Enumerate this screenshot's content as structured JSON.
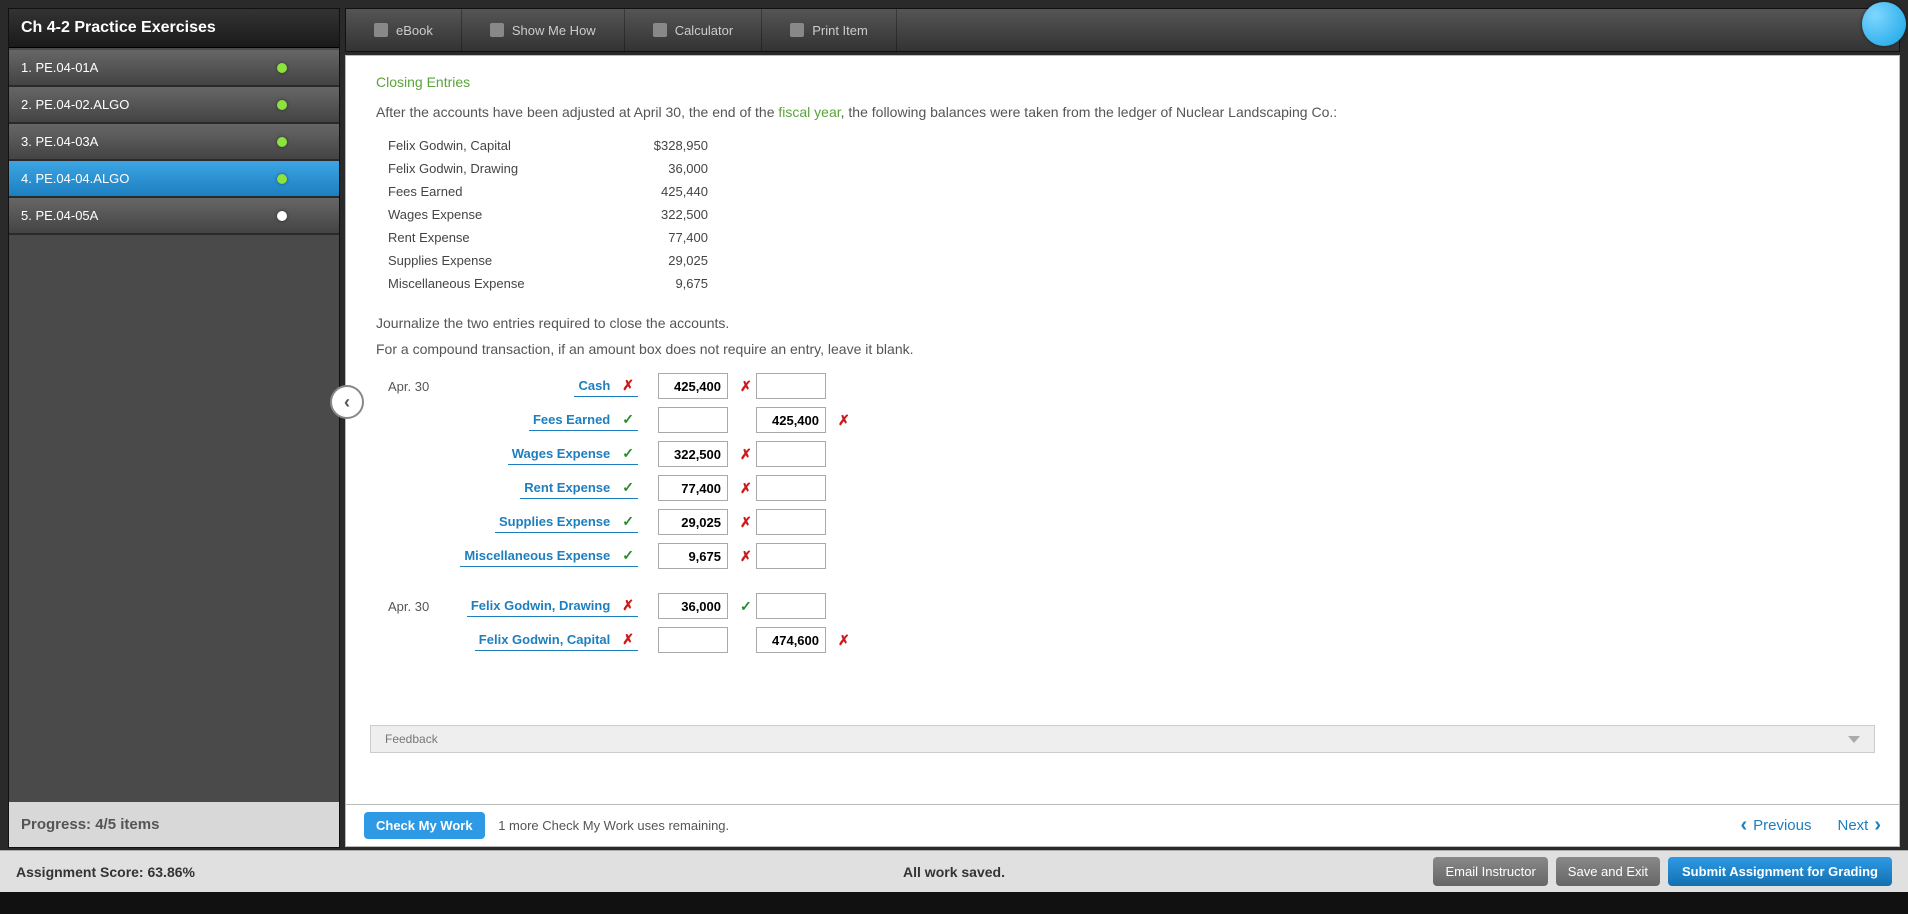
{
  "sidebar": {
    "title": "Ch 4-2 Practice Exercises",
    "items": [
      {
        "label": "1. PE.04-01A",
        "status": "done"
      },
      {
        "label": "2. PE.04-02.ALGO",
        "status": "done"
      },
      {
        "label": "3. PE.04-03A",
        "status": "done"
      },
      {
        "label": "4. PE.04-04.ALGO",
        "status": "current"
      },
      {
        "label": "5. PE.04-05A",
        "status": "not"
      }
    ],
    "progress_label": "Progress:",
    "progress_value": "4/5 items"
  },
  "toolbar": {
    "ebook": "eBook",
    "show_me_how": "Show Me How",
    "calculator": "Calculator",
    "print_item": "Print Item"
  },
  "content": {
    "heading": "Closing Entries",
    "intro_pre": "After the accounts have been adjusted at April 30, the end of the ",
    "intro_link": "fiscal year",
    "intro_post": ", the following balances were taken from the ledger of Nuclear Landscaping Co.:",
    "balances": [
      {
        "label": "Felix Godwin, Capital",
        "value": "$328,950"
      },
      {
        "label": "Felix Godwin, Drawing",
        "value": "36,000"
      },
      {
        "label": "Fees Earned",
        "value": "425,440"
      },
      {
        "label": "Wages Expense",
        "value": "322,500"
      },
      {
        "label": "Rent Expense",
        "value": "77,400"
      },
      {
        "label": "Supplies Expense",
        "value": "29,025"
      },
      {
        "label": "Miscellaneous Expense",
        "value": "9,675"
      }
    ],
    "note1": "Journalize the two entries required to close the accounts.",
    "note2": "For a compound transaction, if an amount box does not require an entry, leave it blank.",
    "journal1": {
      "date": "Apr. 30",
      "rows": [
        {
          "account": "Cash",
          "acct_mark": "wrong",
          "debit": "425,400",
          "debit_mark": "wrong",
          "credit": "",
          "credit_mark": ""
        },
        {
          "account": "Fees Earned",
          "acct_mark": "correct",
          "indent": true,
          "debit": "",
          "debit_mark": "",
          "credit": "425,400",
          "credit_mark": "wrong"
        },
        {
          "account": "Wages Expense",
          "acct_mark": "correct",
          "debit": "322,500",
          "debit_mark": "wrong",
          "credit": "",
          "credit_mark": ""
        },
        {
          "account": "Rent Expense",
          "acct_mark": "correct",
          "debit": "77,400",
          "debit_mark": "wrong",
          "credit": "",
          "credit_mark": ""
        },
        {
          "account": "Supplies Expense",
          "acct_mark": "correct",
          "debit": "29,025",
          "debit_mark": "wrong",
          "credit": "",
          "credit_mark": ""
        },
        {
          "account": "Miscellaneous Expense",
          "acct_mark": "correct",
          "debit": "9,675",
          "debit_mark": "wrong",
          "credit": "",
          "credit_mark": ""
        }
      ]
    },
    "journal2": {
      "date": "Apr. 30",
      "rows": [
        {
          "account": "Felix Godwin, Drawing",
          "acct_mark": "wrong",
          "debit": "36,000",
          "debit_mark": "correct",
          "credit": "",
          "credit_mark": ""
        },
        {
          "account": "Felix Godwin, Capital",
          "acct_mark": "wrong",
          "indent": true,
          "debit": "",
          "debit_mark": "",
          "credit": "474,600",
          "credit_mark": "wrong"
        }
      ]
    },
    "feedback_label": "Feedback"
  },
  "checkbar": {
    "button": "Check My Work",
    "remaining": "1 more Check My Work uses remaining.",
    "previous": "Previous",
    "next": "Next"
  },
  "statusbar": {
    "score_label": "Assignment Score: 63.86%",
    "saved": "All work saved.",
    "email": "Email Instructor",
    "save_exit": "Save and Exit",
    "submit": "Submit Assignment for Grading"
  }
}
